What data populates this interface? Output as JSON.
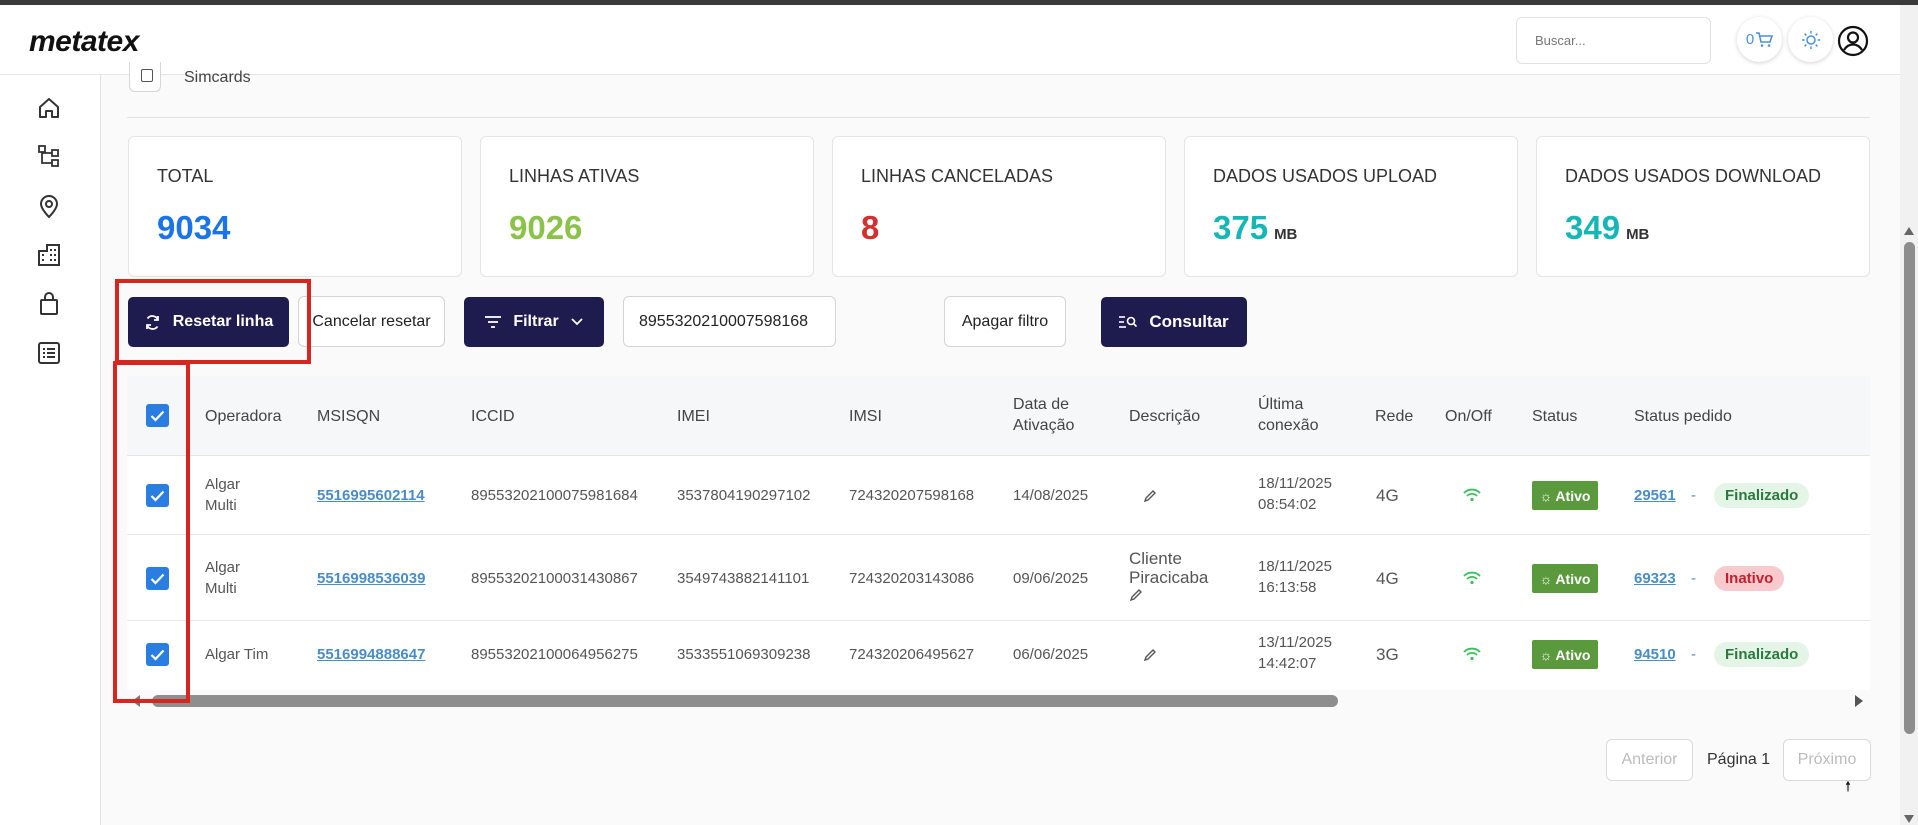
{
  "header": {
    "logo": "metatex",
    "search_placeholder": "Buscar...",
    "cart_count": "0",
    "icons": [
      "cart-icon",
      "sun-icon",
      "user-icon"
    ]
  },
  "sidebar": {
    "icons": [
      "home-icon",
      "hierarchy-icon",
      "location-pin-icon",
      "buildings-icon",
      "shopping-bag-icon",
      "list-icon"
    ]
  },
  "page": {
    "title": "Simcards"
  },
  "stats": [
    {
      "label": "TOTAL",
      "value": "9034",
      "unit": "",
      "color": "#1a73e8"
    },
    {
      "label": "LINHAS ATIVAS",
      "value": "9026",
      "unit": "",
      "color": "#8bc34a"
    },
    {
      "label": "LINHAS CANCELADAS",
      "value": "8",
      "unit": "",
      "color": "#d32f2f"
    },
    {
      "label": "DADOS USADOS UPLOAD",
      "value": "375",
      "unit": "MB",
      "color": "#16b5b8"
    },
    {
      "label": "DADOS USADOS DOWNLOAD",
      "value": "349",
      "unit": "MB",
      "color": "#16b5b8"
    }
  ],
  "toolbar": {
    "reset_label": "Resetar linha",
    "cancel_reset_label": "Cancelar resetar",
    "filter_label": "Filtrar",
    "filter_value": "8955320210007598168",
    "clear_filter_label": "Apagar filtro",
    "query_label": "Consultar"
  },
  "table": {
    "headers": {
      "operadora": "Operadora",
      "msisqn": "MSISQN",
      "iccid": "ICCID",
      "imei": "IMEI",
      "imsi": "IMSI",
      "data_ativacao": "Data de Ativação",
      "descricao": "Descrição",
      "ultima_conexao": "Última conexão",
      "rede": "Rede",
      "onoff": "On/Off",
      "status": "Status",
      "status_pedido": "Status pedido"
    },
    "rows": [
      {
        "operadora": "Algar Multi",
        "msisqn": "5516995602114",
        "iccid": "89553202100075981684",
        "imei": "3537804190297102",
        "imsi": "724320207598168",
        "data_ativacao": "14/08/2025",
        "descricao": "",
        "ultima_conexao": "18/11/2025 08:54:02",
        "rede": "4G",
        "status": "Ativo",
        "pedido": "29561",
        "sep": "-",
        "pedido_status": "Finalizado"
      },
      {
        "operadora": "Algar Multi",
        "msisqn": "5516998536039",
        "iccid": "89553202100031430867",
        "imei": "3549743882141101",
        "imsi": "724320203143086",
        "data_ativacao": "09/06/2025",
        "descricao": "Cliente Piracicaba",
        "ultima_conexao": "18/11/2025 16:13:58",
        "rede": "4G",
        "status": "Ativo",
        "pedido": "69323",
        "sep": "-",
        "pedido_status": "Inativo"
      },
      {
        "operadora": "Algar Tim",
        "msisqn": "5516994888647",
        "iccid": "89553202100064956275",
        "imei": "3533551069309238",
        "imsi": "724320206495627",
        "data_ativacao": "06/06/2025",
        "descricao": "",
        "ultima_conexao": "13/11/2025 14:42:07",
        "rede": "3G",
        "status": "Ativo",
        "pedido": "94510",
        "sep": "-",
        "pedido_status": "Finalizado"
      }
    ]
  },
  "pagination": {
    "prev_label": "Anterior",
    "page_label": "Página 1",
    "next_label": "Próximo"
  },
  "colors": {
    "primary_dark": "#1e1b4e",
    "checkbox": "#2a7de1",
    "highlight": "#d9251f",
    "badge_ativo": "#5a9a3d"
  }
}
